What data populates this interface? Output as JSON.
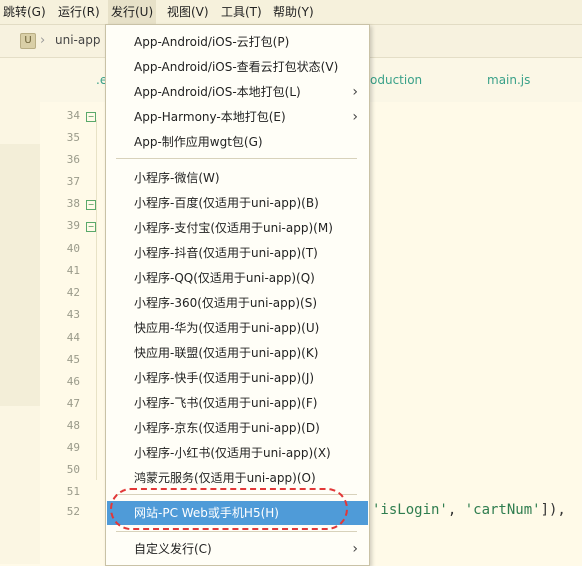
{
  "menubar": {
    "items": [
      "跳转(G)",
      "运行(R)",
      "发行(U)",
      "视图(V)",
      "工具(T)",
      "帮助(Y)"
    ]
  },
  "breadcrumb": {
    "project": "uni-app"
  },
  "file_tabs": [
    ".e",
    "oduction",
    "main.js"
  ],
  "line_numbers": [
    "34",
    "35",
    "36",
    "37",
    "38",
    "39",
    "40",
    "41",
    "42",
    "43",
    "44",
    "45",
    "46",
    "47",
    "48",
    "49",
    "50",
    "51",
    "52"
  ],
  "code": {
    "line52_a": "'isLogin'",
    "line52_b": ", ",
    "line52_c": "'cartNum'",
    "line52_d": "]),"
  },
  "menu": {
    "items": [
      {
        "label": "App-Android/iOS-云打包(P)"
      },
      {
        "label": "App-Android/iOS-查看云打包状态(V)"
      },
      {
        "label": "App-Android/iOS-本地打包(L)"
      },
      {
        "label": "App-Harmony-本地打包(E)"
      },
      {
        "label": "App-制作应用wgt包(G)"
      },
      {
        "label": "小程序-微信(W)"
      },
      {
        "label": "小程序-百度(仅适用于uni-app)(B)"
      },
      {
        "label": "小程序-支付宝(仅适用于uni-app)(M)"
      },
      {
        "label": "小程序-抖音(仅适用于uni-app)(T)"
      },
      {
        "label": "小程序-QQ(仅适用于uni-app)(Q)"
      },
      {
        "label": "小程序-360(仅适用于uni-app)(S)"
      },
      {
        "label": "快应用-华为(仅适用于uni-app)(U)"
      },
      {
        "label": "快应用-联盟(仅适用于uni-app)(K)"
      },
      {
        "label": "小程序-快手(仅适用于uni-app)(J)"
      },
      {
        "label": "小程序-飞书(仅适用于uni-app)(F)"
      },
      {
        "label": "小程序-京东(仅适用于uni-app)(D)"
      },
      {
        "label": "小程序-小红书(仅适用于uni-app)(X)"
      },
      {
        "label": "鸿蒙元服务(仅适用于uni-app)(O)"
      },
      {
        "label": "网站-PC Web或手机H5(H)"
      },
      {
        "label": "自定义发行(C)"
      }
    ]
  },
  "colors": {
    "highlight": "#4f9bd8",
    "annotation_ring": "#e23838",
    "editor_bg": "#fffae8"
  }
}
